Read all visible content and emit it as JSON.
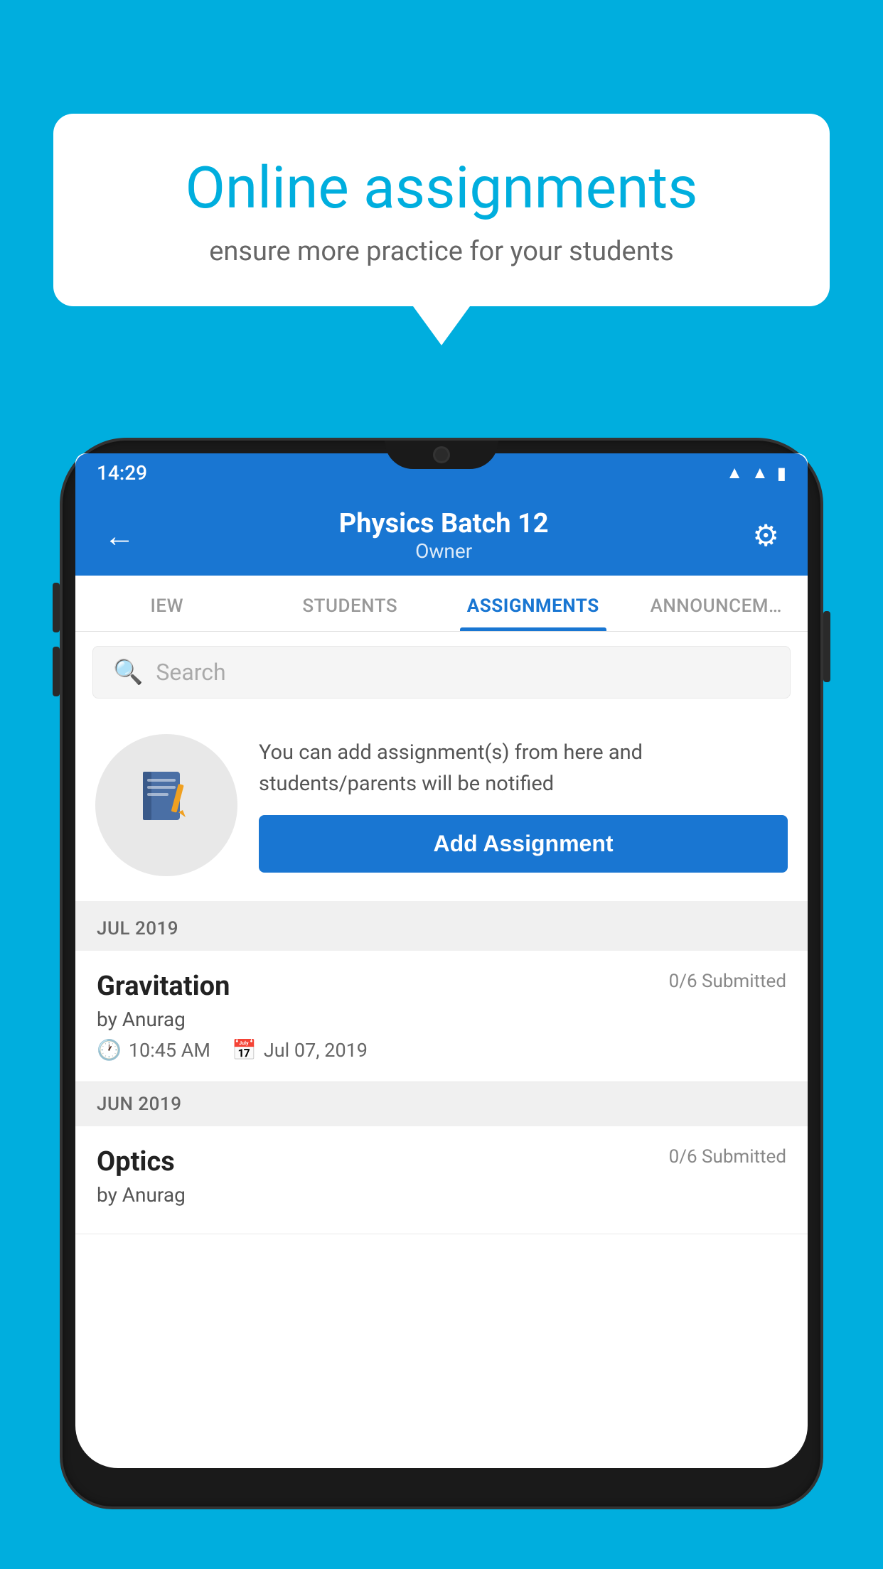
{
  "background_color": "#00AEDE",
  "speech_bubble": {
    "title": "Online assignments",
    "subtitle": "ensure more practice for your students"
  },
  "phone": {
    "status_bar": {
      "time": "14:29",
      "icons": [
        "wifi",
        "signal",
        "battery"
      ]
    },
    "header": {
      "title": "Physics Batch 12",
      "subtitle": "Owner",
      "back_label": "←",
      "settings_label": "⚙"
    },
    "tabs": [
      {
        "label": "IEW",
        "active": false
      },
      {
        "label": "STUDENTS",
        "active": false
      },
      {
        "label": "ASSIGNMENTS",
        "active": true
      },
      {
        "label": "ANNOUNCEM…",
        "active": false
      }
    ],
    "search": {
      "placeholder": "Search"
    },
    "promo": {
      "text": "You can add assignment(s) from here and students/parents will be notified",
      "button_label": "Add Assignment"
    },
    "sections": [
      {
        "header": "JUL 2019",
        "assignments": [
          {
            "name": "Gravitation",
            "submitted": "0/6 Submitted",
            "by": "by Anurag",
            "time": "10:45 AM",
            "date": "Jul 07, 2019"
          }
        ]
      },
      {
        "header": "JUN 2019",
        "assignments": [
          {
            "name": "Optics",
            "submitted": "0/6 Submitted",
            "by": "by Anurag",
            "time": "",
            "date": ""
          }
        ]
      }
    ]
  }
}
